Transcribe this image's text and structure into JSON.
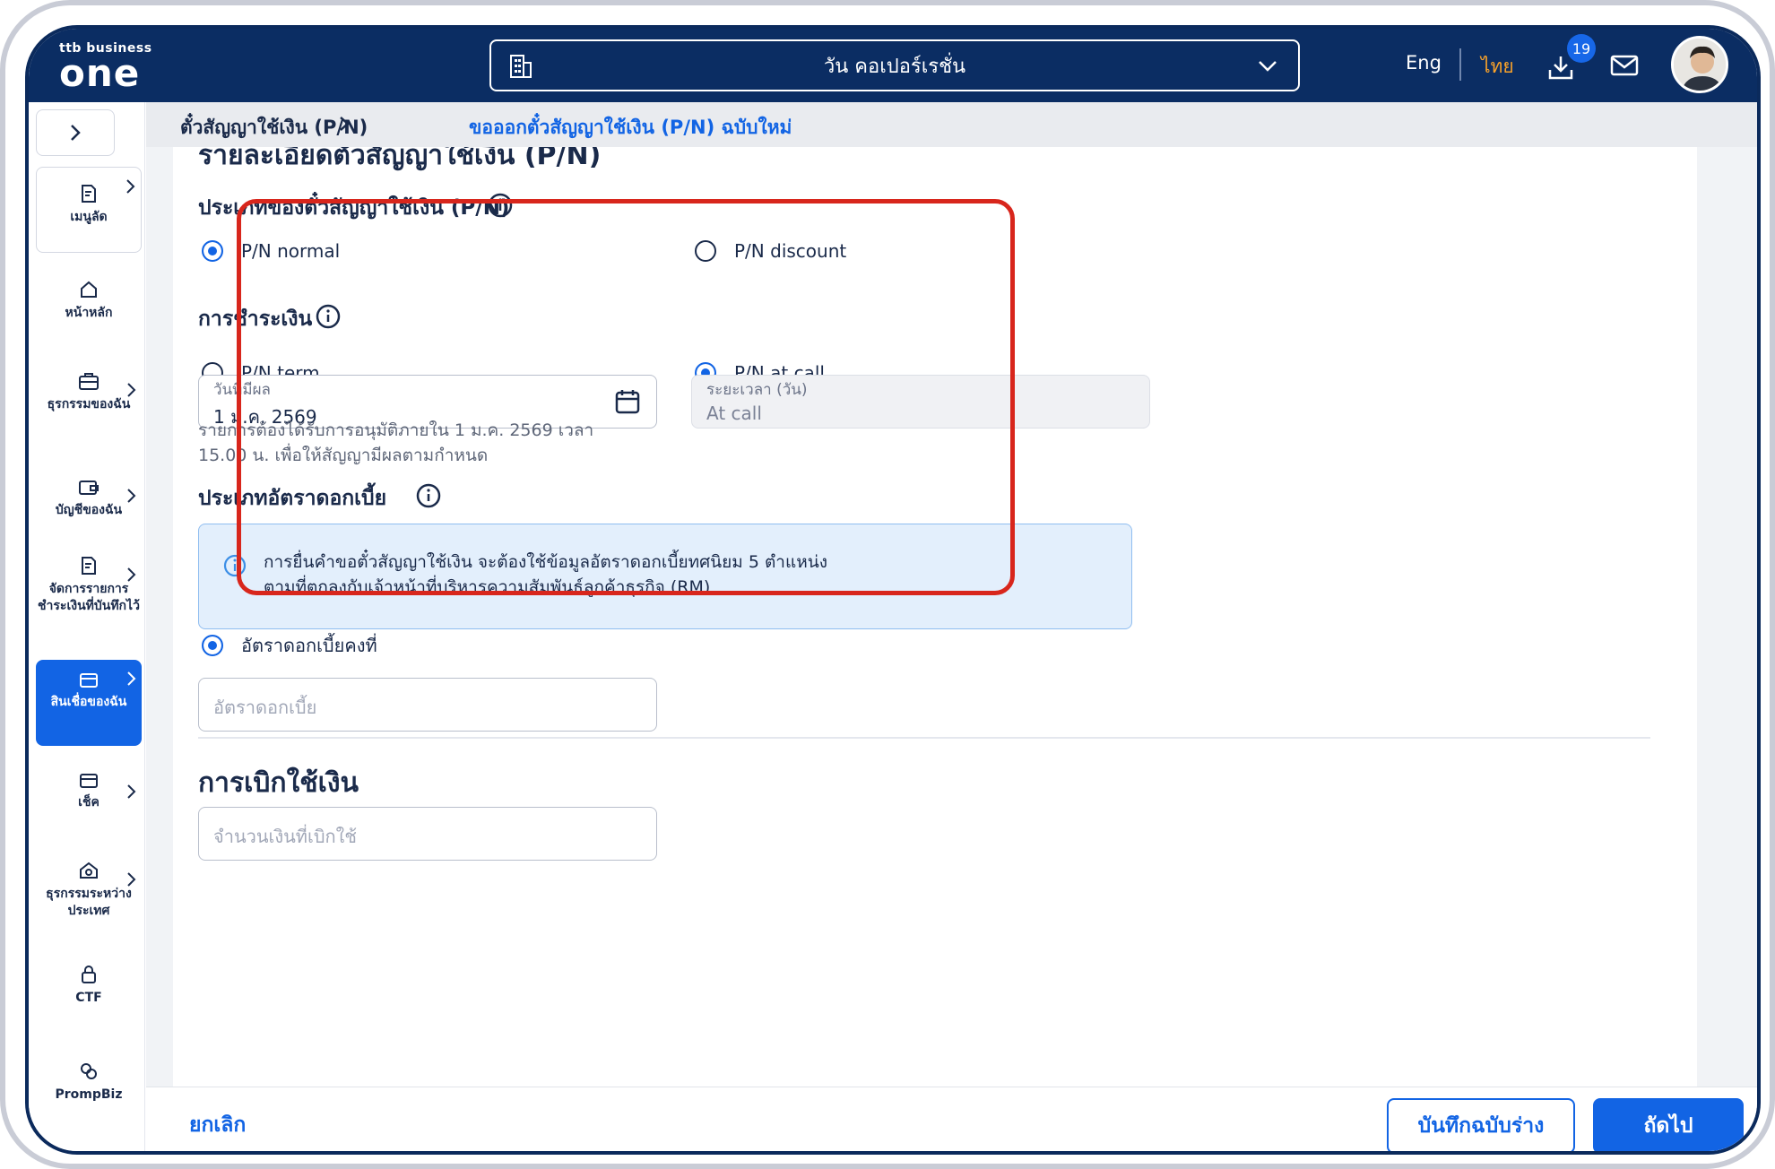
{
  "app": {
    "logo_small": "ttb business",
    "logo_big": "one",
    "company": "วัน คอเปอร์เรชั่น",
    "lang_eng": "Eng",
    "lang_thai": "ไทย",
    "download_count": "19"
  },
  "sidebar": {
    "items": [
      {
        "label": "เมนูลัด",
        "icon": "favorite-menu-icon"
      },
      {
        "label": "หน้าหลัก",
        "icon": "home-icon"
      },
      {
        "label": "ธุรกรรมของฉัน",
        "icon": "briefcase-icon"
      },
      {
        "label": "บัญชีของฉัน",
        "icon": "wallet-icon"
      },
      {
        "label": "จัดการรายการชำระเงินที่บันทึกไว้",
        "icon": "document-edit-icon"
      },
      {
        "label": "สินเชื่อของฉัน",
        "icon": "loan-card-icon"
      },
      {
        "label": "เช็ค",
        "icon": "cheque-icon"
      },
      {
        "label": "ธุรกรรมระหว่างประเทศ",
        "icon": "international-icon"
      },
      {
        "label": "CTF",
        "icon": "lock-icon"
      },
      {
        "label": "PrompBiz",
        "icon": "prompbiz-icon"
      }
    ]
  },
  "breadcrumb": {
    "level1": "ตั๋วสัญญาใช้เงิน (P/N)",
    "level2": "ขอออกตั๋วสัญญาใช้เงิน (P/N) ฉบับใหม่"
  },
  "form": {
    "section_title": "รายละเอียดตั๋วสัญญาใช้เงิน (P/N)",
    "pn_type": {
      "heading": "ประเภทของตั๋วสัญญาใช้เงิน (P/N)",
      "option_normal": "P/N normal",
      "option_discount": "P/N discount"
    },
    "payment": {
      "heading": "การชำระเงิน",
      "option_term": "P/N term",
      "option_atcall": "P/N at call"
    },
    "effective_date": {
      "label": "วันที่มีผล",
      "value": "1 ม.ค. 2569",
      "helper_line1": "รายการต้องได้รับการอนุมัติภายใน 1 ม.ค. 2569 เวลา",
      "helper_line2": "15.00 น. เพื่อให้สัญญามีผลตามกำหนด"
    },
    "duration": {
      "label": "ระยะเวลา (วัน)",
      "value": "At call"
    },
    "interest": {
      "heading": "ประเภทอัตราดอกเบี้ย",
      "notice_line1": "การยื่นคำขอตั๋วสัญญาใช้เงิน จะต้องใช้ข้อมูลอัตราดอกเบี้ยทศนิยม 5 ตำแหน่ง",
      "notice_line2": "ตามที่ตกลงกับเจ้าหน้าที่บริหารความสัมพันธ์ลูกค้าธุรกิจ (RM)",
      "option_fixed": "อัตราดอกเบี้ยคงที่",
      "rate_placeholder": "อัตราดอกเบี้ย"
    },
    "drawdown": {
      "heading": "การเบิกใช้เงิน",
      "amount_placeholder": "จำนวนเงินที่เบิกใช้"
    }
  },
  "footer": {
    "cancel": "ยกเลิก",
    "save_draft": "บันทึกฉบับร่าง",
    "next": "ถัดไป"
  },
  "colors": {
    "brand_navy": "#0b2d63",
    "primary_blue": "#1264e4",
    "lang_active": "#f7a12a",
    "highlight_red": "#d8261c"
  }
}
